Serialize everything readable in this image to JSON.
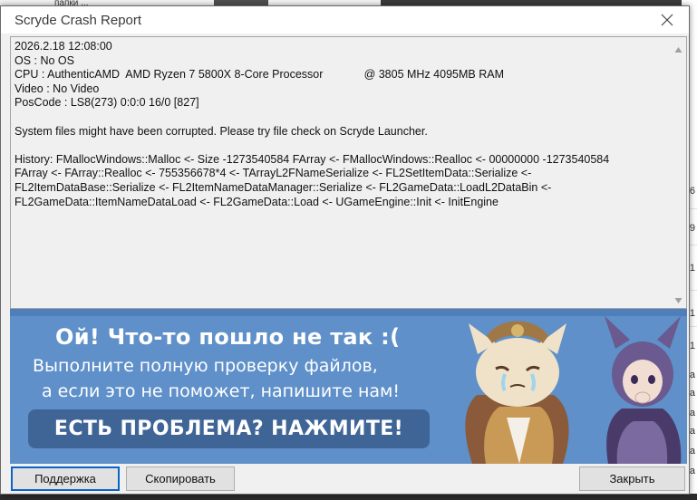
{
  "dialog": {
    "title": "Scryde Crash Report",
    "log_lines": [
      "2026.2.18 12:08:00",
      "OS : No OS",
      "CPU : AuthenticAMD  AMD Ryzen 7 5800X 8-Core Processor             @ 3805 MHz 4095MB RAM",
      "Video : No Video",
      "PosCode : LS8(273) 0:0:0 16/0 [827]",
      "",
      "System files might have been corrupted. Please try file check on Scryde Launcher.",
      "",
      "History: FMallocWindows::Malloc <- Size -1273540584 FArray <- FMallocWindows::Realloc <- 00000000 -1273540584",
      "FArray <- FArray::Realloc <- 755356678*4 <- TArrayL2FNameSerialize <- FL2SetItemData::Serialize <-",
      "FL2ItemDataBase::Serialize <- FL2ItemNameDataManager::Serialize <- FL2GameData::LoadL2DataBin <-",
      "FL2GameData::ItemNameDataLoad <- FL2GameData::Load <- UGameEngine::Init <- InitEngine"
    ]
  },
  "banner": {
    "headline": "Ой! Что-то пошло не так :(",
    "line1": "Выполните полную проверку файлов,",
    "line2": "а если это не поможет, напишите нам!",
    "cta": "ЕСТЬ ПРОБЛЕМА? НАЖМИТЕ!"
  },
  "buttons": {
    "support": "Поддержка",
    "copy": "Скопировать",
    "close": "Закрыть"
  },
  "background": {
    "tab_fragment": "папки ...",
    "right_fragments": [
      "6",
      "9",
      "1",
      "1",
      "1",
      "a",
      "a",
      "a",
      "a",
      "a",
      "a"
    ]
  },
  "colors": {
    "banner_bg": "#5f90c9",
    "cta_bg": "#3f6597",
    "focus_border": "#0a64c8"
  },
  "icons": {
    "close": "close-icon",
    "scroll_up": "scroll-up-arrow-icon",
    "scroll_down": "scroll-down-arrow-icon"
  }
}
